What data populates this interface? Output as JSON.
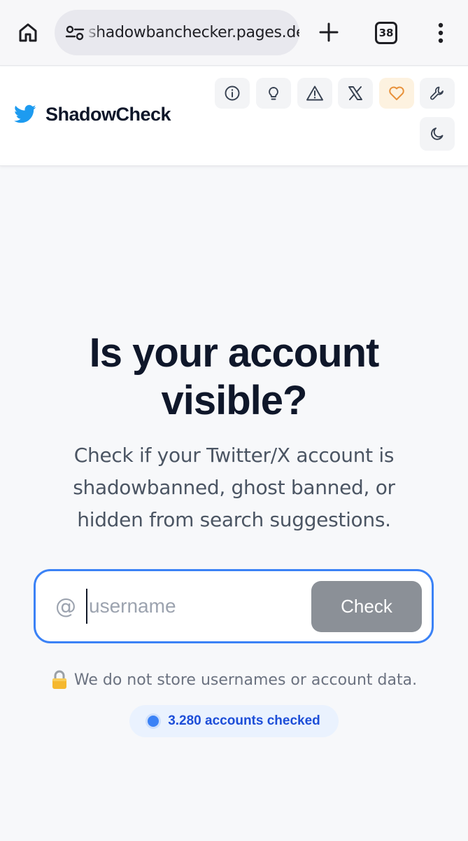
{
  "browser": {
    "url": "shadowbanchecker.pages.dev",
    "tab_count": "38"
  },
  "header": {
    "brand_name": "ShadowCheck",
    "brand_icon": "twitter-bird-icon",
    "toolbar_icons": [
      "info-icon",
      "lightbulb-icon",
      "warning-icon",
      "x-logo-icon",
      "heart-icon",
      "wrench-icon",
      "moon-icon"
    ]
  },
  "hero": {
    "title_line1": "Is your account",
    "title_line2": "visible?",
    "subtitle": "Check if your Twitter/X account is shadowbanned, ghost banned, or hidden from search suggestions."
  },
  "search": {
    "prefix": "@",
    "placeholder": "username",
    "value": "",
    "button_label": "Check"
  },
  "privacy": {
    "text": "We do not store usernames or account data."
  },
  "stats": {
    "text": "3.280 accounts checked"
  },
  "colors": {
    "accent": "#3b82f6",
    "twitter_blue": "#1d9bf0",
    "button_disabled": "#8b9097",
    "heart": "#e8913a"
  }
}
